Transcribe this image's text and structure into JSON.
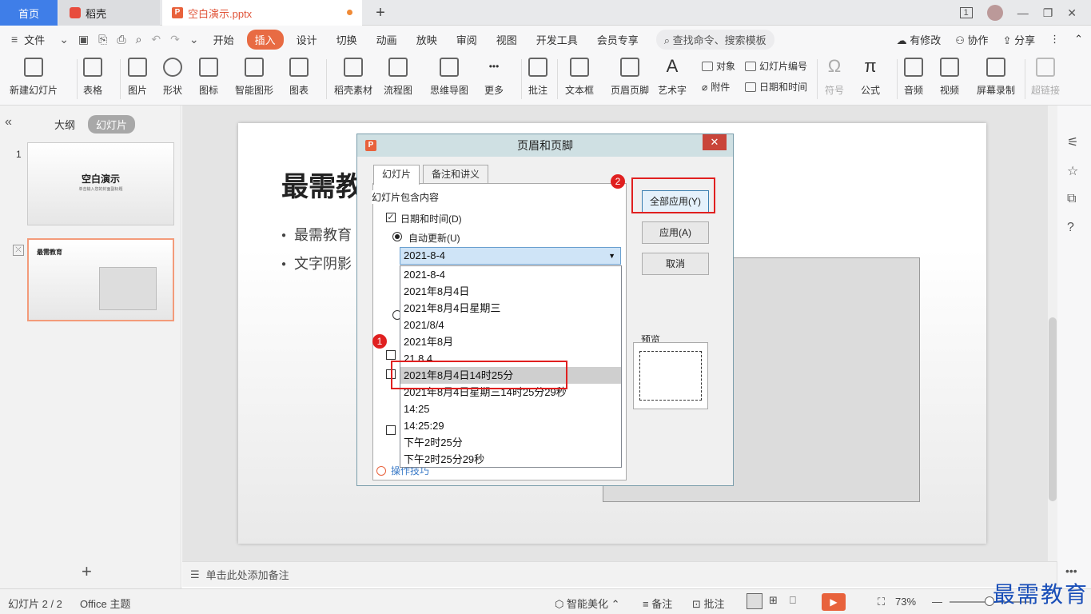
{
  "tabs": {
    "home": "首页",
    "docer": "稻壳",
    "file": "空白演示.pptx",
    "new_tab": "+"
  },
  "window": {
    "page_indicator": "1",
    "minimize": "—",
    "restore": "❐",
    "close": "✕"
  },
  "menu": {
    "file": "文件",
    "items": [
      "开始",
      "插入",
      "设计",
      "切换",
      "动画",
      "放映",
      "审阅",
      "视图",
      "开发工具",
      "会员专享"
    ],
    "active": "插入",
    "search_placeholder": "查找命令、搜索模板",
    "right": [
      "有修改",
      "协作",
      "分享"
    ]
  },
  "ribbon": {
    "new_slide": "新建幻灯片",
    "table": "表格",
    "picture": "图片",
    "shape": "形状",
    "icon": "图标",
    "smart_graphic": "智能图形",
    "chart": "图表",
    "docer_material": "稻壳素材",
    "flowchart": "流程图",
    "mindmap": "思维导图",
    "more": "更多",
    "comment": "批注",
    "textbox": "文本框",
    "header_footer": "页眉页脚",
    "art_text": "艺术字",
    "object": "对象",
    "attachment": "附件",
    "slide_number": "幻灯片编号",
    "date_time": "日期和时间",
    "symbol": "符号",
    "formula": "公式",
    "audio": "音频",
    "video": "视频",
    "screen_record": "屏幕录制",
    "hyperlink": "超链接"
  },
  "left_pane": {
    "outline": "大纲",
    "slides": "幻灯片",
    "slide1_num": "1",
    "slide1_title": "空白演示",
    "slide1_sub": "单击输入您的封面副标题",
    "slide2_num": "2",
    "slide2_title": "最需教育",
    "add": "+"
  },
  "slide": {
    "title": "最需教",
    "bullets": [
      "最需教育",
      "文字阴影"
    ]
  },
  "notes_placeholder": "单击此处添加备注",
  "status": {
    "slide_counter": "幻灯片 2 / 2",
    "theme": "Office 主题",
    "beautify": "智能美化",
    "notes": "备注",
    "comments": "批注",
    "zoom": "73%"
  },
  "watermark": "最需教育",
  "dialog": {
    "title": "页眉和页脚",
    "close": "✕",
    "tab_slide": "幻灯片",
    "tab_notes": "备注和讲义",
    "group_label": "幻灯片包含内容",
    "date_time_label": "日期和时间(D)",
    "auto_update_label": "自动更新(U)",
    "selected_format": "2021-8-4",
    "options": [
      "2021-8-4",
      "2021年8月4日",
      "2021年8月4日星期三",
      "2021/8/4",
      "2021年8月",
      "21.8.4",
      "2021年8月4日14时25分",
      "2021年8月4日星期三14时25分29秒",
      "14:25",
      "14:25:29",
      "下午2时25分",
      "下午2时25分29秒"
    ],
    "highlighted_option": "2021年8月4日14时25分",
    "apply_all": "全部应用(Y)",
    "apply": "应用(A)",
    "cancel": "取消",
    "preview": "预览",
    "tips": "操作技巧"
  },
  "annotations": {
    "badge1": "1",
    "badge2": "2",
    "accent": "#e02020"
  }
}
